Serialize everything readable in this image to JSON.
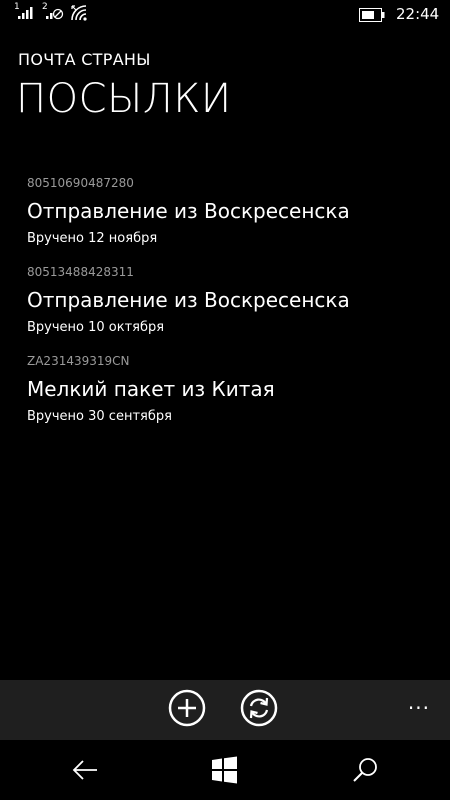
{
  "status_bar": {
    "sim1_label": "1",
    "sim2_label": "2",
    "time": "22:44",
    "icons": [
      "signal-icon",
      "sim2-no-service-icon",
      "wifi-icon",
      "battery-icon"
    ]
  },
  "header": {
    "app_title": "ПОЧТА СТРАНЫ",
    "page_title": "ПОСЫЛКИ"
  },
  "parcels": [
    {
      "tracking": "80510690487280",
      "title": "Отправление из Воскресенска",
      "status": "Вручено 12 ноября"
    },
    {
      "tracking": "80513488428311",
      "title": "Отправление из Воскресенска",
      "status": "Вручено 10 октября"
    },
    {
      "tracking": "ZA231439319CN",
      "title": "Мелкий пакет из Китая",
      "status": "Вручено 30 сентября"
    }
  ],
  "app_bar": {
    "buttons": [
      "add-icon",
      "refresh-icon"
    ],
    "more_label": "···"
  },
  "nav_bar": {
    "buttons": [
      "back-icon",
      "windows-icon",
      "search-icon"
    ]
  },
  "colors": {
    "background": "#000000",
    "secondary_text": "#9a9a9a",
    "app_bar": "#1f1f1f"
  }
}
